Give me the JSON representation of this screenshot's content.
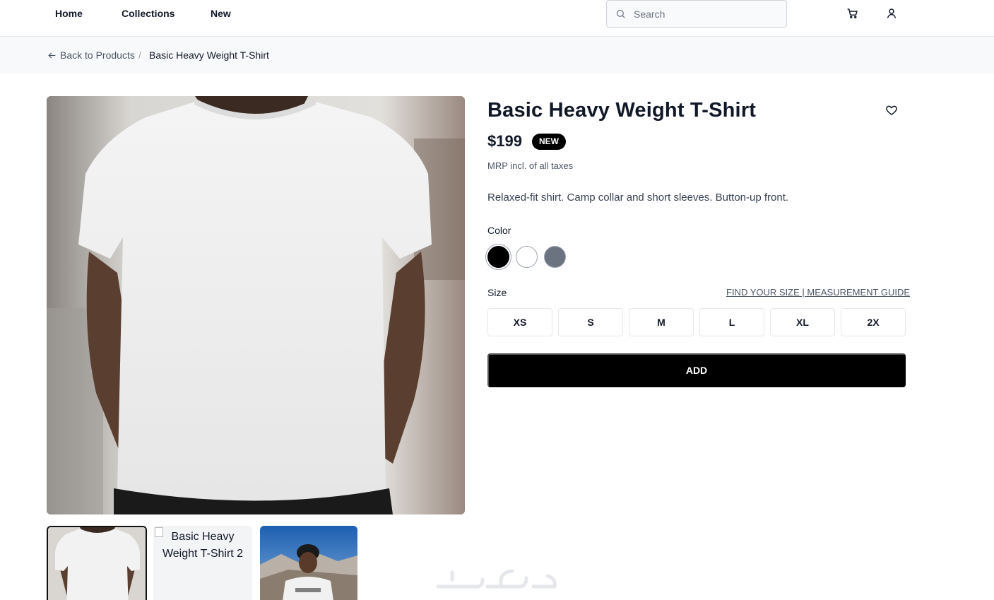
{
  "nav": {
    "links": [
      "Home",
      "Collections",
      "New"
    ],
    "search_placeholder": "Search"
  },
  "breadcrumb": {
    "back_label": "Back to Products",
    "separator": "/",
    "current": "Basic Heavy Weight T-Shirt"
  },
  "gallery": {
    "thumbnail_alt_2": "Basic Heavy Weight T-Shirt 2"
  },
  "product": {
    "title": "Basic Heavy Weight T-Shirt",
    "price": "$199",
    "badge": "NEW",
    "tax_note": "MRP incl. of all taxes",
    "description": "Relaxed-fit shirt. Camp collar and short sleeves. Button-up front.",
    "color_label": "Color",
    "colors": [
      {
        "name": "black",
        "hex": "#000000",
        "selected": true
      },
      {
        "name": "white",
        "hex": "#ffffff",
        "selected": false
      },
      {
        "name": "gray",
        "hex": "#6b7280",
        "selected": false
      }
    ],
    "size_label": "Size",
    "size_guide_link": "FIND YOUR SIZE | MEASUREMENT GUIDE",
    "sizes": [
      "XS",
      "S",
      "M",
      "L",
      "XL",
      "2X"
    ],
    "add_label": "ADD"
  },
  "icons": {
    "search": "search-icon",
    "cart": "cart-icon",
    "account": "user-icon",
    "favorite": "heart-icon",
    "back": "arrow-left-icon"
  }
}
